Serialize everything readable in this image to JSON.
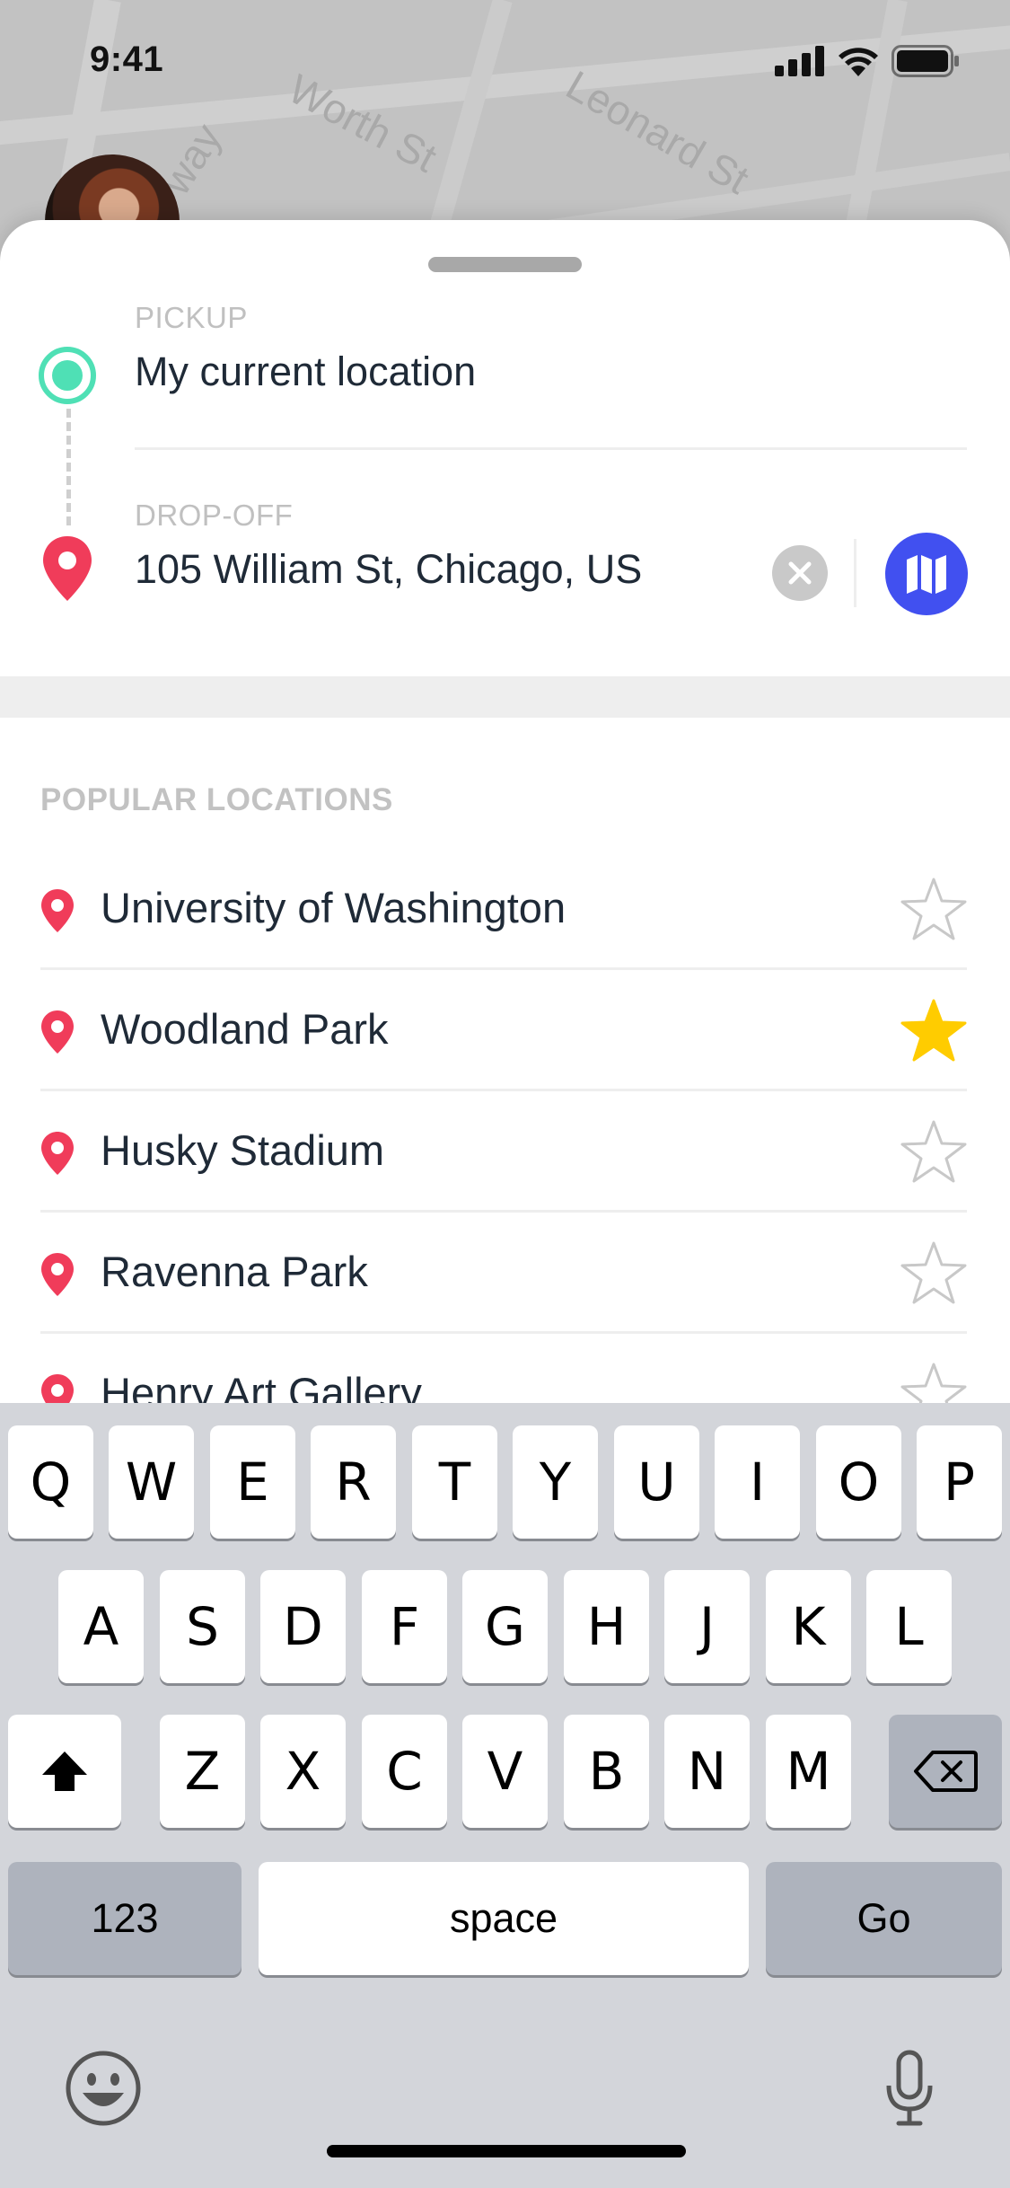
{
  "status_bar": {
    "time": "9:41"
  },
  "map": {
    "street_labels": [
      "way",
      "Worth St",
      "Leonard St"
    ]
  },
  "route": {
    "pickup_label": "PICKUP",
    "pickup_value": "My current location",
    "dropoff_label": "DROP-OFF",
    "dropoff_value": "105 William St, Chicago, US"
  },
  "popular": {
    "header": "POPULAR LOCATIONS",
    "items": [
      {
        "name": "University of Washington",
        "favorite": false
      },
      {
        "name": "Woodland Park",
        "favorite": true
      },
      {
        "name": "Husky Stadium",
        "favorite": false
      },
      {
        "name": "Ravenna Park",
        "favorite": false
      },
      {
        "name": "Henry Art Gallery",
        "favorite": false
      }
    ]
  },
  "keyboard": {
    "row1": [
      "Q",
      "W",
      "E",
      "R",
      "T",
      "Y",
      "U",
      "I",
      "O",
      "P"
    ],
    "row2": [
      "A",
      "S",
      "D",
      "F",
      "G",
      "H",
      "J",
      "K",
      "L"
    ],
    "row3": [
      "Z",
      "X",
      "C",
      "V",
      "B",
      "N",
      "M"
    ],
    "numbers_key": "123",
    "space_key": "space",
    "go_key": "Go"
  },
  "colors": {
    "accent": "#4150f0",
    "pickup": "#4fe0b5",
    "pin": "#f03c5a",
    "favorite_star": "#ffcc00"
  }
}
